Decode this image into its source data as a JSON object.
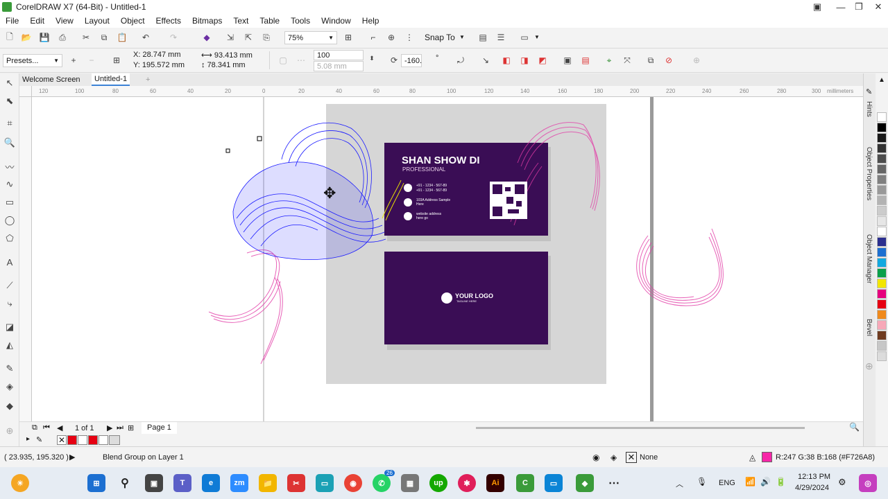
{
  "window": {
    "title": "CorelDRAW X7 (64-Bit) - Untitled-1"
  },
  "menu": [
    "File",
    "Edit",
    "View",
    "Layout",
    "Object",
    "Effects",
    "Bitmaps",
    "Text",
    "Table",
    "Tools",
    "Window",
    "Help"
  ],
  "toolbar": {
    "zoom": "75%",
    "snap_to": "Snap To"
  },
  "property_bar": {
    "presets": "Presets...",
    "x": "X: 28.747 mm",
    "y": "Y: 195.572 mm",
    "width": "93.413 mm",
    "height": "78.341 mm",
    "steps": "100",
    "spacing": "5.08 mm",
    "rotation": "-160."
  },
  "tabs": [
    "Welcome Screen",
    "Untitled-1"
  ],
  "ruler": {
    "unit": "millimeters",
    "ticks": [
      "120",
      "100",
      "80",
      "60",
      "40",
      "20",
      "0",
      "20",
      "40",
      "60",
      "80",
      "100",
      "120",
      "140",
      "160",
      "180",
      "200",
      "220",
      "240",
      "260",
      "280",
      "300"
    ]
  },
  "card": {
    "name": "SHAN SHOW DI",
    "role": "PROFESSIONAL",
    "phone1": "+91 - 1234 - 567-89",
    "phone2": "+91 - 1234 - 567-89",
    "address1": "103A Address Sample",
    "address2": "Here",
    "web1": "website address",
    "web2": "here go",
    "logo": "YOUR LOGO",
    "tagline": "TAGLINE HERE"
  },
  "page_nav": {
    "count": "1 of 1",
    "page": "Page 1"
  },
  "status": {
    "coords": "( 23.935, 195.320 )",
    "object": "Blend Group on Layer 1",
    "outline": "None",
    "fill": "R:247 G:38 B:168 (#F726A8)"
  },
  "dockers": [
    "Hints",
    "Object Properties",
    "Object Manager",
    "Bevel"
  ],
  "palette_colors": [
    "#ffffff",
    "#000000",
    "#1a1a1a",
    "#333333",
    "#4d4d4d",
    "#666666",
    "#808080",
    "#999999",
    "#b3b3b3",
    "#cccccc",
    "#e6e6e6",
    "#ffffff",
    "#2b2f8f",
    "#1c6fd1",
    "#12a9e0",
    "#0aa04a",
    "#f2e600",
    "#e6007e",
    "#e60012",
    "#f08a1c",
    "#f7a8b8",
    "#6f3b1f",
    "#c7c7c7",
    "#dcdcdc"
  ],
  "colors": {
    "accent": "#F726A8",
    "card_bg": "#3a0d55",
    "blend_blue": "#1a1aff",
    "page_gray": "#d6d6d6"
  },
  "taskbar": {
    "time": "12:13 PM",
    "date": "4/29/2024",
    "lang": "ENG",
    "badge_whatsapp": "26"
  }
}
